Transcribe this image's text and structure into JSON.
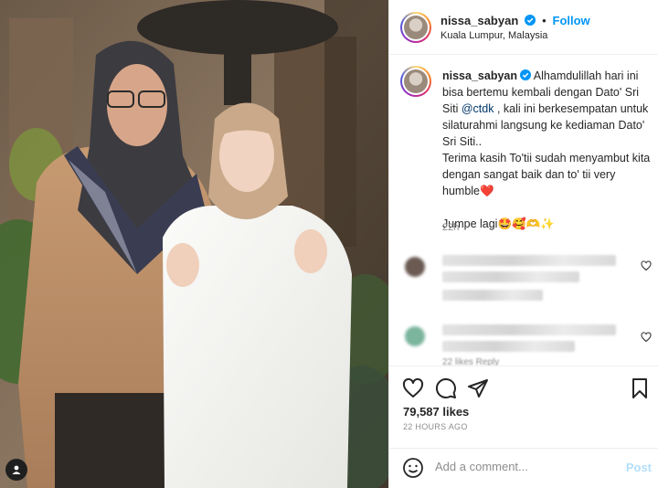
{
  "post": {
    "author": "nissa_sabyan",
    "follow_label": "Follow",
    "separator": "•",
    "location": "Kuala Lumpur, Malaysia"
  },
  "caption": {
    "author": "nissa_sabyan",
    "text_1": "Alhamdulillah hari ini bisa bertemu kembali dengan Dato' Sri Siti ",
    "mention": "@ctdk",
    "text_2": " , kali ini berkesempatan untuk silaturahmi langsung ke kediaman Dato' Sri Siti..",
    "text_3": "Terima kasih To'tii sudah menyambut kita dengan sangat baik dan to' tii very humble",
    "heart_emoji": "❤️",
    "text_4": "Jumpe lagi",
    "emojis": "🤩🥰🫶✨",
    "time": "22h"
  },
  "comments": {
    "partial_text": "22 likes  Reply"
  },
  "actions": {
    "like_icon": "heart-icon",
    "comment_icon": "comment-icon",
    "share_icon": "share-icon",
    "save_icon": "bookmark-icon"
  },
  "stats": {
    "likes": "79,587 likes",
    "posted_ago": "22 HOURS AGO"
  },
  "add_comment": {
    "placeholder": "Add a comment...",
    "post_label": "Post"
  },
  "colors": {
    "link_blue": "#0095f6",
    "mention_blue": "#00376b",
    "post_disabled": "#b2dffc",
    "heart_red": "#ed2d4c"
  }
}
